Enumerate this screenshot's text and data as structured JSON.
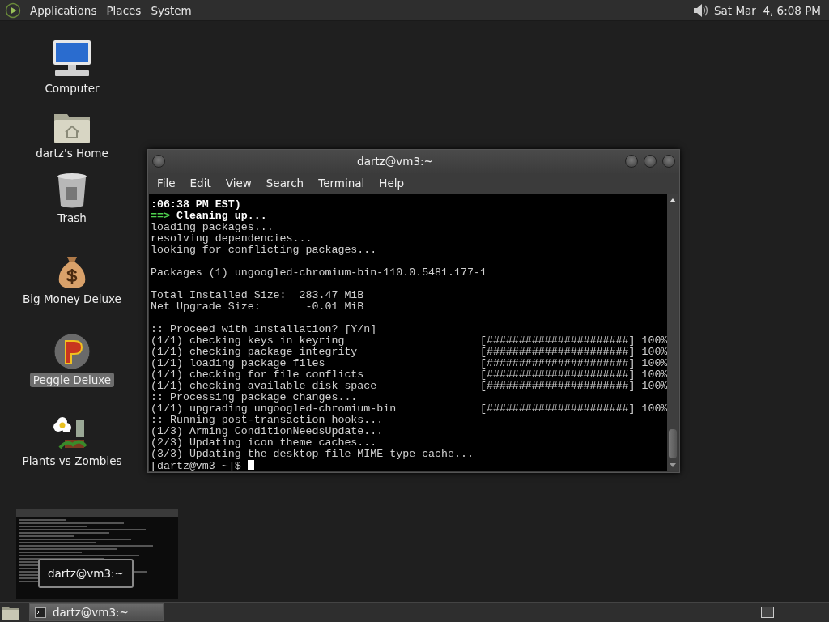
{
  "top_panel": {
    "menus": [
      "Applications",
      "Places",
      "System"
    ],
    "clock": "Sat Mar  4, 6:08 PM"
  },
  "desktop_icons": [
    {
      "kind": "computer",
      "label": "Computer",
      "selected": false
    },
    {
      "kind": "home",
      "label": "dartz's Home",
      "selected": false
    },
    {
      "kind": "trash",
      "label": "Trash",
      "selected": false
    },
    {
      "kind": "money",
      "label": "Big Money Deluxe",
      "selected": false
    },
    {
      "kind": "peggle",
      "label": "Peggle Deluxe",
      "selected": true
    },
    {
      "kind": "plants",
      "label": "Plants vs Zombies",
      "selected": false
    }
  ],
  "window": {
    "title": "dartz@vm3:~",
    "menu": [
      "File",
      "Edit",
      "View",
      "Search",
      "Terminal",
      "Help"
    ],
    "lines": [
      {
        "kind": "bold",
        "text": ":06:38 PM EST)"
      },
      {
        "kind": "arrow",
        "arrow": "==>",
        "text": " Cleaning up..."
      },
      {
        "kind": "plain",
        "text": "loading packages..."
      },
      {
        "kind": "plain",
        "text": "resolving dependencies..."
      },
      {
        "kind": "plain",
        "text": "looking for conflicting packages..."
      },
      {
        "kind": "blank"
      },
      {
        "kind": "plain",
        "text": "Packages (1) ungoogled-chromium-bin-110.0.5481.177-1"
      },
      {
        "kind": "blank"
      },
      {
        "kind": "plain",
        "text": "Total Installed Size:  283.47 MiB"
      },
      {
        "kind": "plain",
        "text": "Net Upgrade Size:       -0.01 MiB"
      },
      {
        "kind": "blank"
      },
      {
        "kind": "plain",
        "text": ":: Proceed with installation? [Y/n]"
      },
      {
        "kind": "progress",
        "text": "(1/1) checking keys in keyring",
        "bar": "[######################]",
        "percent": "100%"
      },
      {
        "kind": "progress",
        "text": "(1/1) checking package integrity",
        "bar": "[######################]",
        "percent": "100%"
      },
      {
        "kind": "progress",
        "text": "(1/1) loading package files",
        "bar": "[######################]",
        "percent": "100%"
      },
      {
        "kind": "progress",
        "text": "(1/1) checking for file conflicts",
        "bar": "[######################]",
        "percent": "100%"
      },
      {
        "kind": "progress",
        "text": "(1/1) checking available disk space",
        "bar": "[######################]",
        "percent": "100%"
      },
      {
        "kind": "plain",
        "text": ":: Processing package changes..."
      },
      {
        "kind": "progress",
        "text": "(1/1) upgrading ungoogled-chromium-bin",
        "bar": "[######################]",
        "percent": "100%"
      },
      {
        "kind": "plain",
        "text": ":: Running post-transaction hooks..."
      },
      {
        "kind": "plain",
        "text": "(1/3) Arming ConditionNeedsUpdate..."
      },
      {
        "kind": "plain",
        "text": "(2/3) Updating icon theme caches..."
      },
      {
        "kind": "plain",
        "text": "(3/3) Updating the desktop file MIME type cache..."
      },
      {
        "kind": "prompt",
        "text": "[dartz@vm3 ~]$ "
      }
    ]
  },
  "preview_tooltip": "dartz@vm3:~",
  "taskbar": {
    "tasks": [
      {
        "label": "dartz@vm3:~",
        "selected": true
      }
    ]
  }
}
